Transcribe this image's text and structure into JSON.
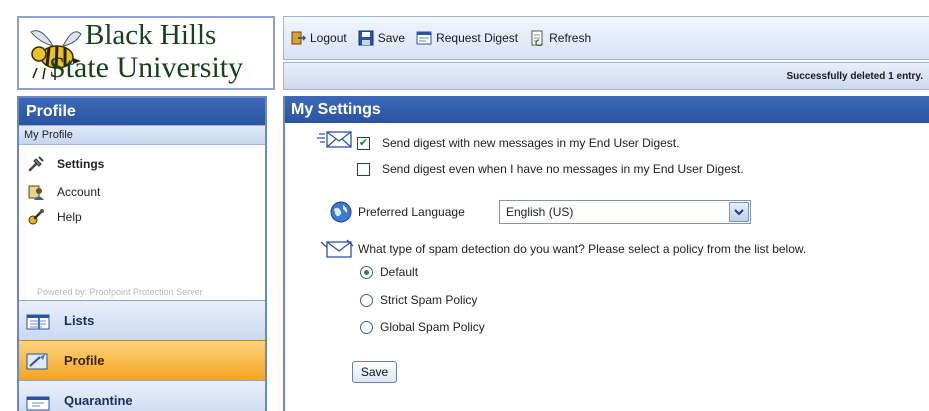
{
  "logo": {
    "line1": "Black Hills",
    "line2": "State University"
  },
  "sidebar": {
    "header": "Profile",
    "subheader": "My Profile",
    "items": [
      {
        "label": "Settings",
        "icon": "settings-icon",
        "active": true
      },
      {
        "label": "Account",
        "icon": "account-icon",
        "active": false
      },
      {
        "label": "Help",
        "icon": "help-icon",
        "active": false
      }
    ],
    "powered_by": "Powered by: Proofpoint Protection Server",
    "nav": [
      {
        "label": "Lists",
        "icon": "lists-icon"
      },
      {
        "label": "Profile",
        "icon": "profile-icon",
        "active": true
      },
      {
        "label": "Quarantine",
        "icon": "quarantine-icon"
      }
    ]
  },
  "toolbar": {
    "logout": "Logout",
    "save": "Save",
    "request_digest": "Request Digest",
    "refresh": "Refresh"
  },
  "status": {
    "message": "Successfully deleted 1 entry."
  },
  "main": {
    "title": "My Settings",
    "digest": {
      "option1": {
        "label": "Send digest with new messages in my End User Digest.",
        "checked": true
      },
      "option2": {
        "label": "Send digest even when I have no messages in my End User Digest.",
        "checked": false
      }
    },
    "language": {
      "label": "Preferred Language",
      "selected": "English (US)"
    },
    "spam": {
      "question": "What type of spam detection do you want? Please select a policy from the list below.",
      "options": [
        {
          "label": "Default",
          "selected": true
        },
        {
          "label": "Strict Spam Policy",
          "selected": false
        },
        {
          "label": "Global Spam Policy",
          "selected": false
        }
      ]
    },
    "save_label": "Save"
  },
  "colors": {
    "header_blue": "#2a54a0",
    "active_nav_orange": "#f4a420",
    "logo_green": "#18401a"
  }
}
